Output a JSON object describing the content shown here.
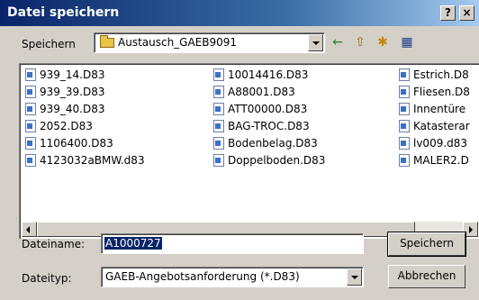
{
  "window": {
    "title": "Datei speichern",
    "help_label": "?",
    "close_label": "×"
  },
  "save_in": {
    "label": "Speichern",
    "folder": "Austausch_GAEB9091"
  },
  "toolbar": {
    "back_icon": "←",
    "up_icon": "⇧",
    "new_folder_icon": "✱",
    "view_icon": "▦"
  },
  "files": {
    "col1": [
      "939_14.D83",
      "939_39.D83",
      "939_40.D83",
      "2052.D83",
      "1106400.D83",
      "4123032aBMW.d83"
    ],
    "col2": [
      "10014416.D83",
      "A88001.D83",
      "ATT00000.D83",
      "BAG-TROC.D83",
      "Bodenbelag.D83",
      "Doppelboden.D83"
    ],
    "col3": [
      "Estrich.D8",
      "Fliesen.D8",
      "Innentüre",
      "Katasterar",
      "lv009.d83",
      "MALER2.D"
    ]
  },
  "filename": {
    "label": "Dateiname:",
    "value": "A1000727"
  },
  "filetype": {
    "label": "Dateityp:",
    "value": "GAEB-Angebotsanforderung (*.D83)"
  },
  "buttons": {
    "save": "Speichern",
    "cancel": "Abbrechen"
  }
}
